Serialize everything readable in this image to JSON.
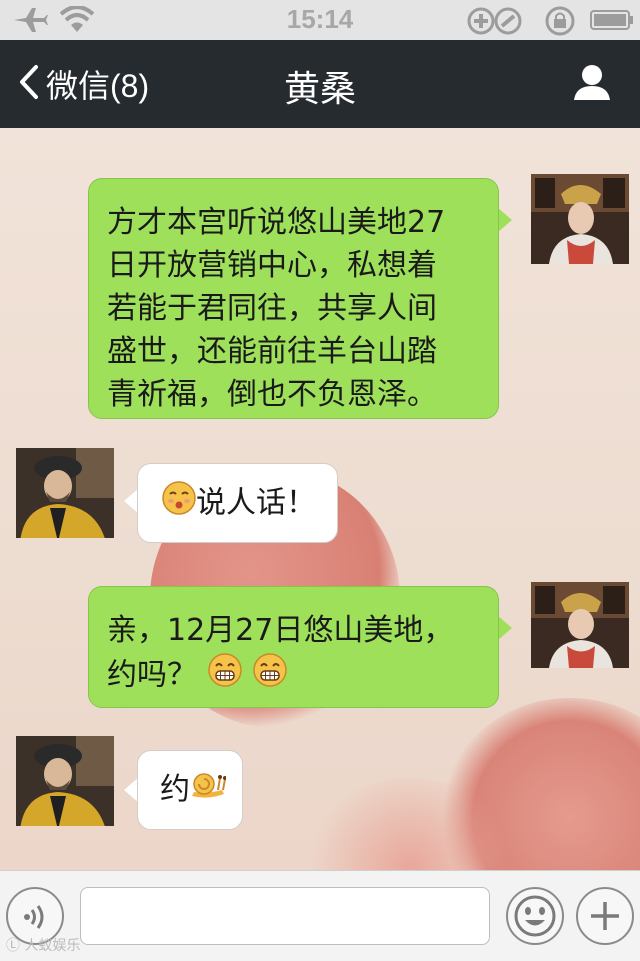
{
  "status_bar": {
    "time": "15:14",
    "icons": [
      "airplane-icon",
      "wifi-icon",
      "rotation-lock-icon",
      "alarm-lock-icon",
      "battery-icon"
    ]
  },
  "nav": {
    "back_label": "微信(8)",
    "title": "黄桑",
    "profile_icon": "person-icon"
  },
  "messages": [
    {
      "side": "right",
      "text": "方才本宫听说悠山美地27日开放营销中心，私想着若能于君同往，共享人间盛世，还能前往羊台山踏青祈福，倒也不负恩泽。"
    },
    {
      "side": "left",
      "text": "说人话！",
      "emoji": "sour-face-emoji"
    },
    {
      "side": "right",
      "text": "亲，12月27日悠山美地，约吗？",
      "emoji": "grin-emoji"
    },
    {
      "side": "left",
      "text": "约",
      "emoji": "snail-emoji"
    }
  ],
  "line_breaks": {
    "m0": [
      "方才本宫听说悠山美地27",
      "日开放营销中心，私想着",
      "若能于君同往，共享人间",
      "盛世，还能前往羊台山踏",
      "青祈福，倒也不负恩泽。"
    ],
    "m2": [
      "亲，12月27日悠山美地，",
      "约吗？"
    ]
  },
  "input": {
    "placeholder": "",
    "value": ""
  },
  "watermark": "Ⓛ 人蚁娱乐",
  "colors": {
    "nav_bg": "#262b2f",
    "bubble_green": "#9ee05a",
    "bubble_white": "#ffffff"
  }
}
